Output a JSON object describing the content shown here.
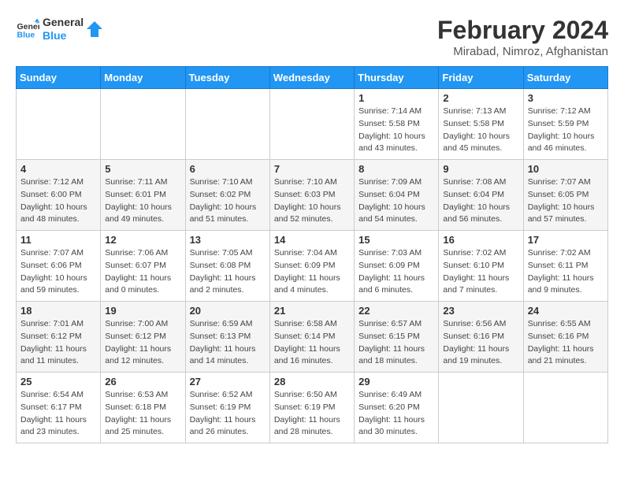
{
  "header": {
    "logo_line1": "General",
    "logo_line2": "Blue",
    "title": "February 2024",
    "subtitle": "Mirabad, Nimroz, Afghanistan"
  },
  "days_of_week": [
    "Sunday",
    "Monday",
    "Tuesday",
    "Wednesday",
    "Thursday",
    "Friday",
    "Saturday"
  ],
  "weeks": [
    [
      {
        "day": "",
        "info": ""
      },
      {
        "day": "",
        "info": ""
      },
      {
        "day": "",
        "info": ""
      },
      {
        "day": "",
        "info": ""
      },
      {
        "day": "1",
        "info": "Sunrise: 7:14 AM\nSunset: 5:58 PM\nDaylight: 10 hours\nand 43 minutes."
      },
      {
        "day": "2",
        "info": "Sunrise: 7:13 AM\nSunset: 5:58 PM\nDaylight: 10 hours\nand 45 minutes."
      },
      {
        "day": "3",
        "info": "Sunrise: 7:12 AM\nSunset: 5:59 PM\nDaylight: 10 hours\nand 46 minutes."
      }
    ],
    [
      {
        "day": "4",
        "info": "Sunrise: 7:12 AM\nSunset: 6:00 PM\nDaylight: 10 hours\nand 48 minutes."
      },
      {
        "day": "5",
        "info": "Sunrise: 7:11 AM\nSunset: 6:01 PM\nDaylight: 10 hours\nand 49 minutes."
      },
      {
        "day": "6",
        "info": "Sunrise: 7:10 AM\nSunset: 6:02 PM\nDaylight: 10 hours\nand 51 minutes."
      },
      {
        "day": "7",
        "info": "Sunrise: 7:10 AM\nSunset: 6:03 PM\nDaylight: 10 hours\nand 52 minutes."
      },
      {
        "day": "8",
        "info": "Sunrise: 7:09 AM\nSunset: 6:04 PM\nDaylight: 10 hours\nand 54 minutes."
      },
      {
        "day": "9",
        "info": "Sunrise: 7:08 AM\nSunset: 6:04 PM\nDaylight: 10 hours\nand 56 minutes."
      },
      {
        "day": "10",
        "info": "Sunrise: 7:07 AM\nSunset: 6:05 PM\nDaylight: 10 hours\nand 57 minutes."
      }
    ],
    [
      {
        "day": "11",
        "info": "Sunrise: 7:07 AM\nSunset: 6:06 PM\nDaylight: 10 hours\nand 59 minutes."
      },
      {
        "day": "12",
        "info": "Sunrise: 7:06 AM\nSunset: 6:07 PM\nDaylight: 11 hours\nand 0 minutes."
      },
      {
        "day": "13",
        "info": "Sunrise: 7:05 AM\nSunset: 6:08 PM\nDaylight: 11 hours\nand 2 minutes."
      },
      {
        "day": "14",
        "info": "Sunrise: 7:04 AM\nSunset: 6:09 PM\nDaylight: 11 hours\nand 4 minutes."
      },
      {
        "day": "15",
        "info": "Sunrise: 7:03 AM\nSunset: 6:09 PM\nDaylight: 11 hours\nand 6 minutes."
      },
      {
        "day": "16",
        "info": "Sunrise: 7:02 AM\nSunset: 6:10 PM\nDaylight: 11 hours\nand 7 minutes."
      },
      {
        "day": "17",
        "info": "Sunrise: 7:02 AM\nSunset: 6:11 PM\nDaylight: 11 hours\nand 9 minutes."
      }
    ],
    [
      {
        "day": "18",
        "info": "Sunrise: 7:01 AM\nSunset: 6:12 PM\nDaylight: 11 hours\nand 11 minutes."
      },
      {
        "day": "19",
        "info": "Sunrise: 7:00 AM\nSunset: 6:12 PM\nDaylight: 11 hours\nand 12 minutes."
      },
      {
        "day": "20",
        "info": "Sunrise: 6:59 AM\nSunset: 6:13 PM\nDaylight: 11 hours\nand 14 minutes."
      },
      {
        "day": "21",
        "info": "Sunrise: 6:58 AM\nSunset: 6:14 PM\nDaylight: 11 hours\nand 16 minutes."
      },
      {
        "day": "22",
        "info": "Sunrise: 6:57 AM\nSunset: 6:15 PM\nDaylight: 11 hours\nand 18 minutes."
      },
      {
        "day": "23",
        "info": "Sunrise: 6:56 AM\nSunset: 6:16 PM\nDaylight: 11 hours\nand 19 minutes."
      },
      {
        "day": "24",
        "info": "Sunrise: 6:55 AM\nSunset: 6:16 PM\nDaylight: 11 hours\nand 21 minutes."
      }
    ],
    [
      {
        "day": "25",
        "info": "Sunrise: 6:54 AM\nSunset: 6:17 PM\nDaylight: 11 hours\nand 23 minutes."
      },
      {
        "day": "26",
        "info": "Sunrise: 6:53 AM\nSunset: 6:18 PM\nDaylight: 11 hours\nand 25 minutes."
      },
      {
        "day": "27",
        "info": "Sunrise: 6:52 AM\nSunset: 6:19 PM\nDaylight: 11 hours\nand 26 minutes."
      },
      {
        "day": "28",
        "info": "Sunrise: 6:50 AM\nSunset: 6:19 PM\nDaylight: 11 hours\nand 28 minutes."
      },
      {
        "day": "29",
        "info": "Sunrise: 6:49 AM\nSunset: 6:20 PM\nDaylight: 11 hours\nand 30 minutes."
      },
      {
        "day": "",
        "info": ""
      },
      {
        "day": "",
        "info": ""
      }
    ]
  ]
}
